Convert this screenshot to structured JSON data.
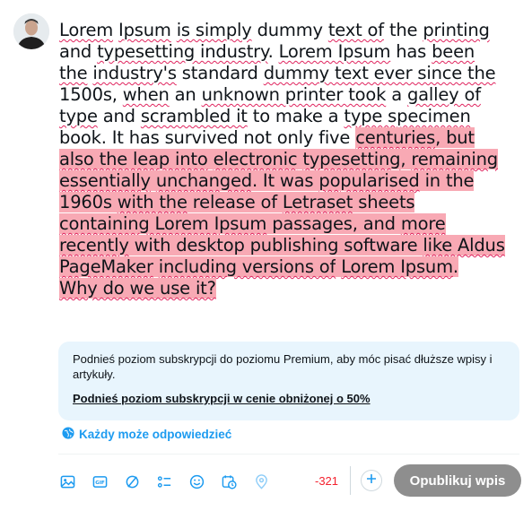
{
  "composer": {
    "segments": [
      {
        "text": "Lorem",
        "sp": true,
        "hl": false
      },
      {
        "text": " ",
        "sp": false,
        "hl": false
      },
      {
        "text": "Ipsum",
        "sp": true,
        "hl": false
      },
      {
        "text": " ",
        "sp": false,
        "hl": false
      },
      {
        "text": "is simply",
        "sp": true,
        "hl": false
      },
      {
        "text": " dummy ",
        "sp": false,
        "hl": false
      },
      {
        "text": "text of",
        "sp": true,
        "hl": false
      },
      {
        "text": " the  ",
        "sp": false,
        "hl": false
      },
      {
        "text": "printing",
        "sp": true,
        "hl": false
      },
      {
        "text": " and ",
        "sp": false,
        "hl": false
      },
      {
        "text": "typesetting industry",
        "sp": true,
        "hl": false
      },
      {
        "text": ". ",
        "sp": false,
        "hl": false
      },
      {
        "text": "Lorem Ipsum",
        "sp": true,
        "hl": false
      },
      {
        "text": " has ",
        "sp": false,
        "hl": false
      },
      {
        "text": "been the",
        "sp": true,
        "hl": false
      },
      {
        "text": " ",
        "sp": false,
        "hl": false
      },
      {
        "text": "industry's",
        "sp": true,
        "hl": false
      },
      {
        "text": "  standard ",
        "sp": false,
        "hl": false
      },
      {
        "text": "dummy text ever since the",
        "sp": true,
        "hl": false
      },
      {
        "text": " 1500s, ",
        "sp": false,
        "hl": false
      },
      {
        "text": "when",
        "sp": true,
        "hl": false
      },
      {
        "text": " an ",
        "sp": false,
        "hl": false
      },
      {
        "text": "unknown printer took",
        "sp": true,
        "hl": false
      },
      {
        "text": " a  ",
        "sp": false,
        "hl": false
      },
      {
        "text": "galley of type",
        "sp": true,
        "hl": false
      },
      {
        "text": " and ",
        "sp": false,
        "hl": false
      },
      {
        "text": "scrambled it",
        "sp": true,
        "hl": false
      },
      {
        "text": " to make a ",
        "sp": false,
        "hl": false
      },
      {
        "text": "type specimen",
        "sp": true,
        "hl": false
      },
      {
        "text": " book. It has survived not only five ",
        "sp": false,
        "hl": false
      },
      {
        "text": "centuries",
        "sp": true,
        "hl": true
      },
      {
        "text": ", but ",
        "sp": false,
        "hl": true
      },
      {
        "text": "also the leap into",
        "sp": true,
        "hl": true
      },
      {
        "text": " ",
        "sp": false,
        "hl": true
      },
      {
        "text": "electronic",
        "sp": true,
        "hl": true
      },
      {
        "text": "  ",
        "sp": false,
        "hl": true
      },
      {
        "text": "typesetting",
        "sp": true,
        "hl": true
      },
      {
        "text": ", ",
        "sp": false,
        "hl": true
      },
      {
        "text": "remaining essentially",
        "sp": true,
        "hl": true
      },
      {
        "text": " ",
        "sp": false,
        "hl": true
      },
      {
        "text": "unchanged",
        "sp": true,
        "hl": true
      },
      {
        "text": ". It was ",
        "sp": false,
        "hl": true
      },
      {
        "text": "popularised",
        "sp": true,
        "hl": true
      },
      {
        "text": " in the  1960s ",
        "sp": false,
        "hl": true
      },
      {
        "text": "with the",
        "sp": true,
        "hl": true
      },
      {
        "text": " release of ",
        "sp": false,
        "hl": true
      },
      {
        "text": "Letraset",
        "sp": true,
        "hl": true
      },
      {
        "text": " sheets ",
        "sp": false,
        "hl": true
      },
      {
        "text": "containing Lorem Ipsum",
        "sp": true,
        "hl": true
      },
      {
        "text": " passages, and ",
        "sp": false,
        "hl": true
      },
      {
        "text": "more recently",
        "sp": true,
        "hl": true
      },
      {
        "text": " with desktop publishing software ",
        "sp": false,
        "hl": true
      },
      {
        "text": "like Aldus",
        "sp": true,
        "hl": true
      },
      {
        "text": "  ",
        "sp": false,
        "hl": true
      },
      {
        "text": "PageMaker",
        "sp": true,
        "hl": true
      },
      {
        "text": " ",
        "sp": false,
        "hl": true
      },
      {
        "text": "including versions of",
        "sp": true,
        "hl": true
      },
      {
        "text": " ",
        "sp": false,
        "hl": true
      },
      {
        "text": "Lorem Ipsum",
        "sp": true,
        "hl": true
      },
      {
        "text": ".",
        "sp": false,
        "hl": true
      }
    ],
    "second_line": "Why do we use it?"
  },
  "premium": {
    "message": "Podnieś poziom subskrypcji do poziomu Premium, aby móc pisać dłuższe wpisy i artykuły.",
    "link": "Podnieś poziom subskrypcji w cenie obniżonej o 50%"
  },
  "reply_setting": {
    "label": "Każdy może odpowiedzieć",
    "icon": "globe-icon"
  },
  "toolbar": {
    "icons": [
      "image-icon",
      "gif-icon",
      "grok-icon",
      "poll-icon",
      "emoji-icon",
      "schedule-icon",
      "location-icon"
    ]
  },
  "counter": "-321",
  "post_button": "Opublikuj wpis",
  "colors": {
    "accent": "#1d9bf0",
    "highlight": "#f8a9b4",
    "counter_red": "#f4212e",
    "premium_bg": "#e8f5fd",
    "post_button_bg": "#8e8e8e"
  }
}
